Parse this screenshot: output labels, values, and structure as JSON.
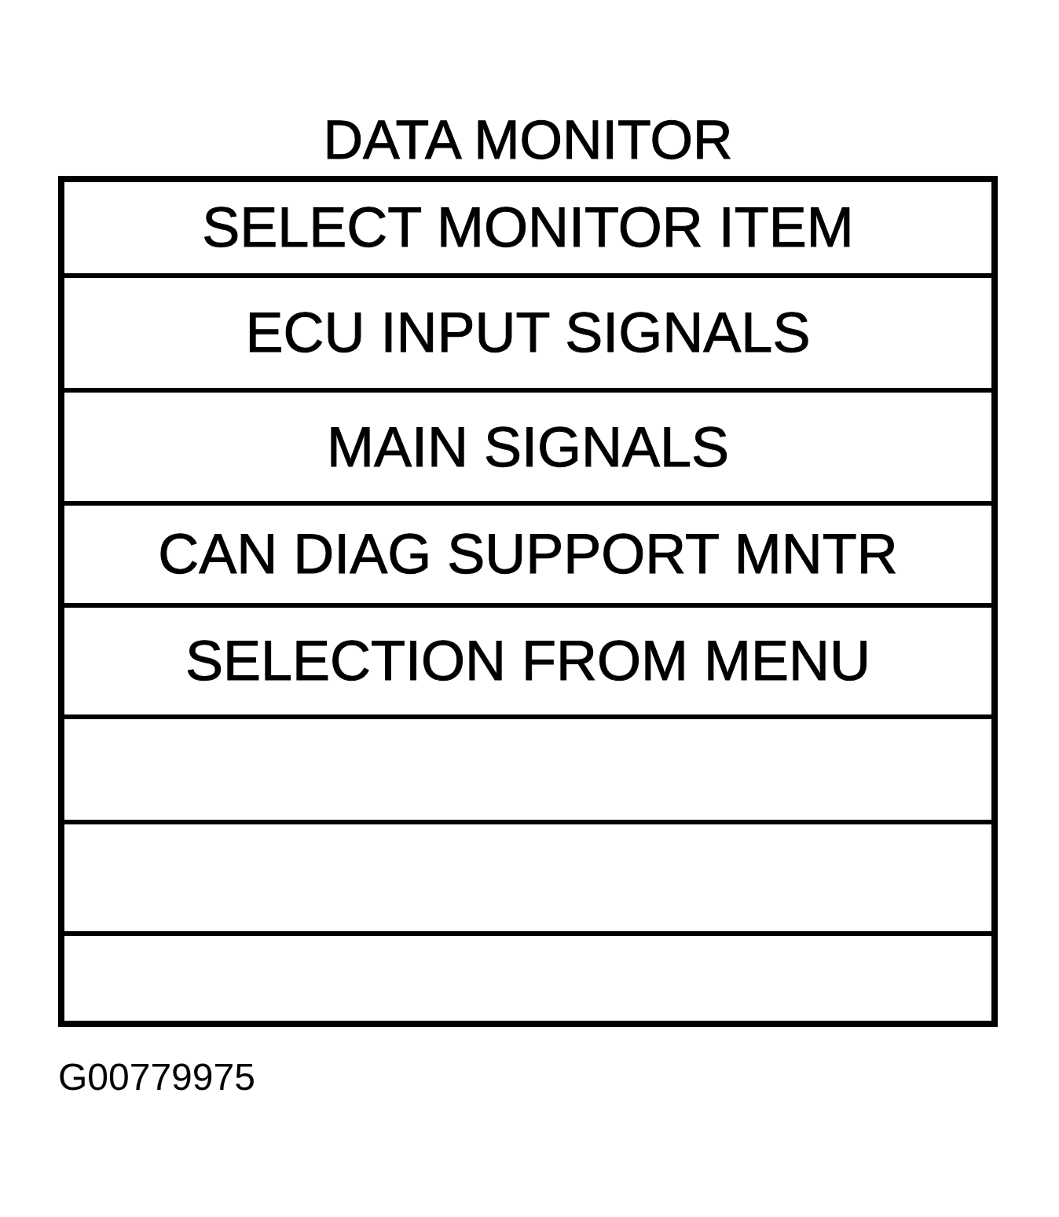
{
  "title": "DATA MONITOR",
  "heading": "SELECT MONITOR ITEM",
  "items": [
    {
      "kind": "option",
      "label": "ECU INPUT SIGNALS"
    },
    {
      "kind": "option",
      "label": "MAIN SIGNALS"
    },
    {
      "kind": "option",
      "label": "CAN DIAG SUPPORT MNTR"
    },
    {
      "kind": "option",
      "label": "SELECTION FROM MENU"
    },
    {
      "kind": "blank"
    },
    {
      "kind": "blank"
    },
    {
      "kind": "blank"
    }
  ],
  "figure_code": "G00779975"
}
